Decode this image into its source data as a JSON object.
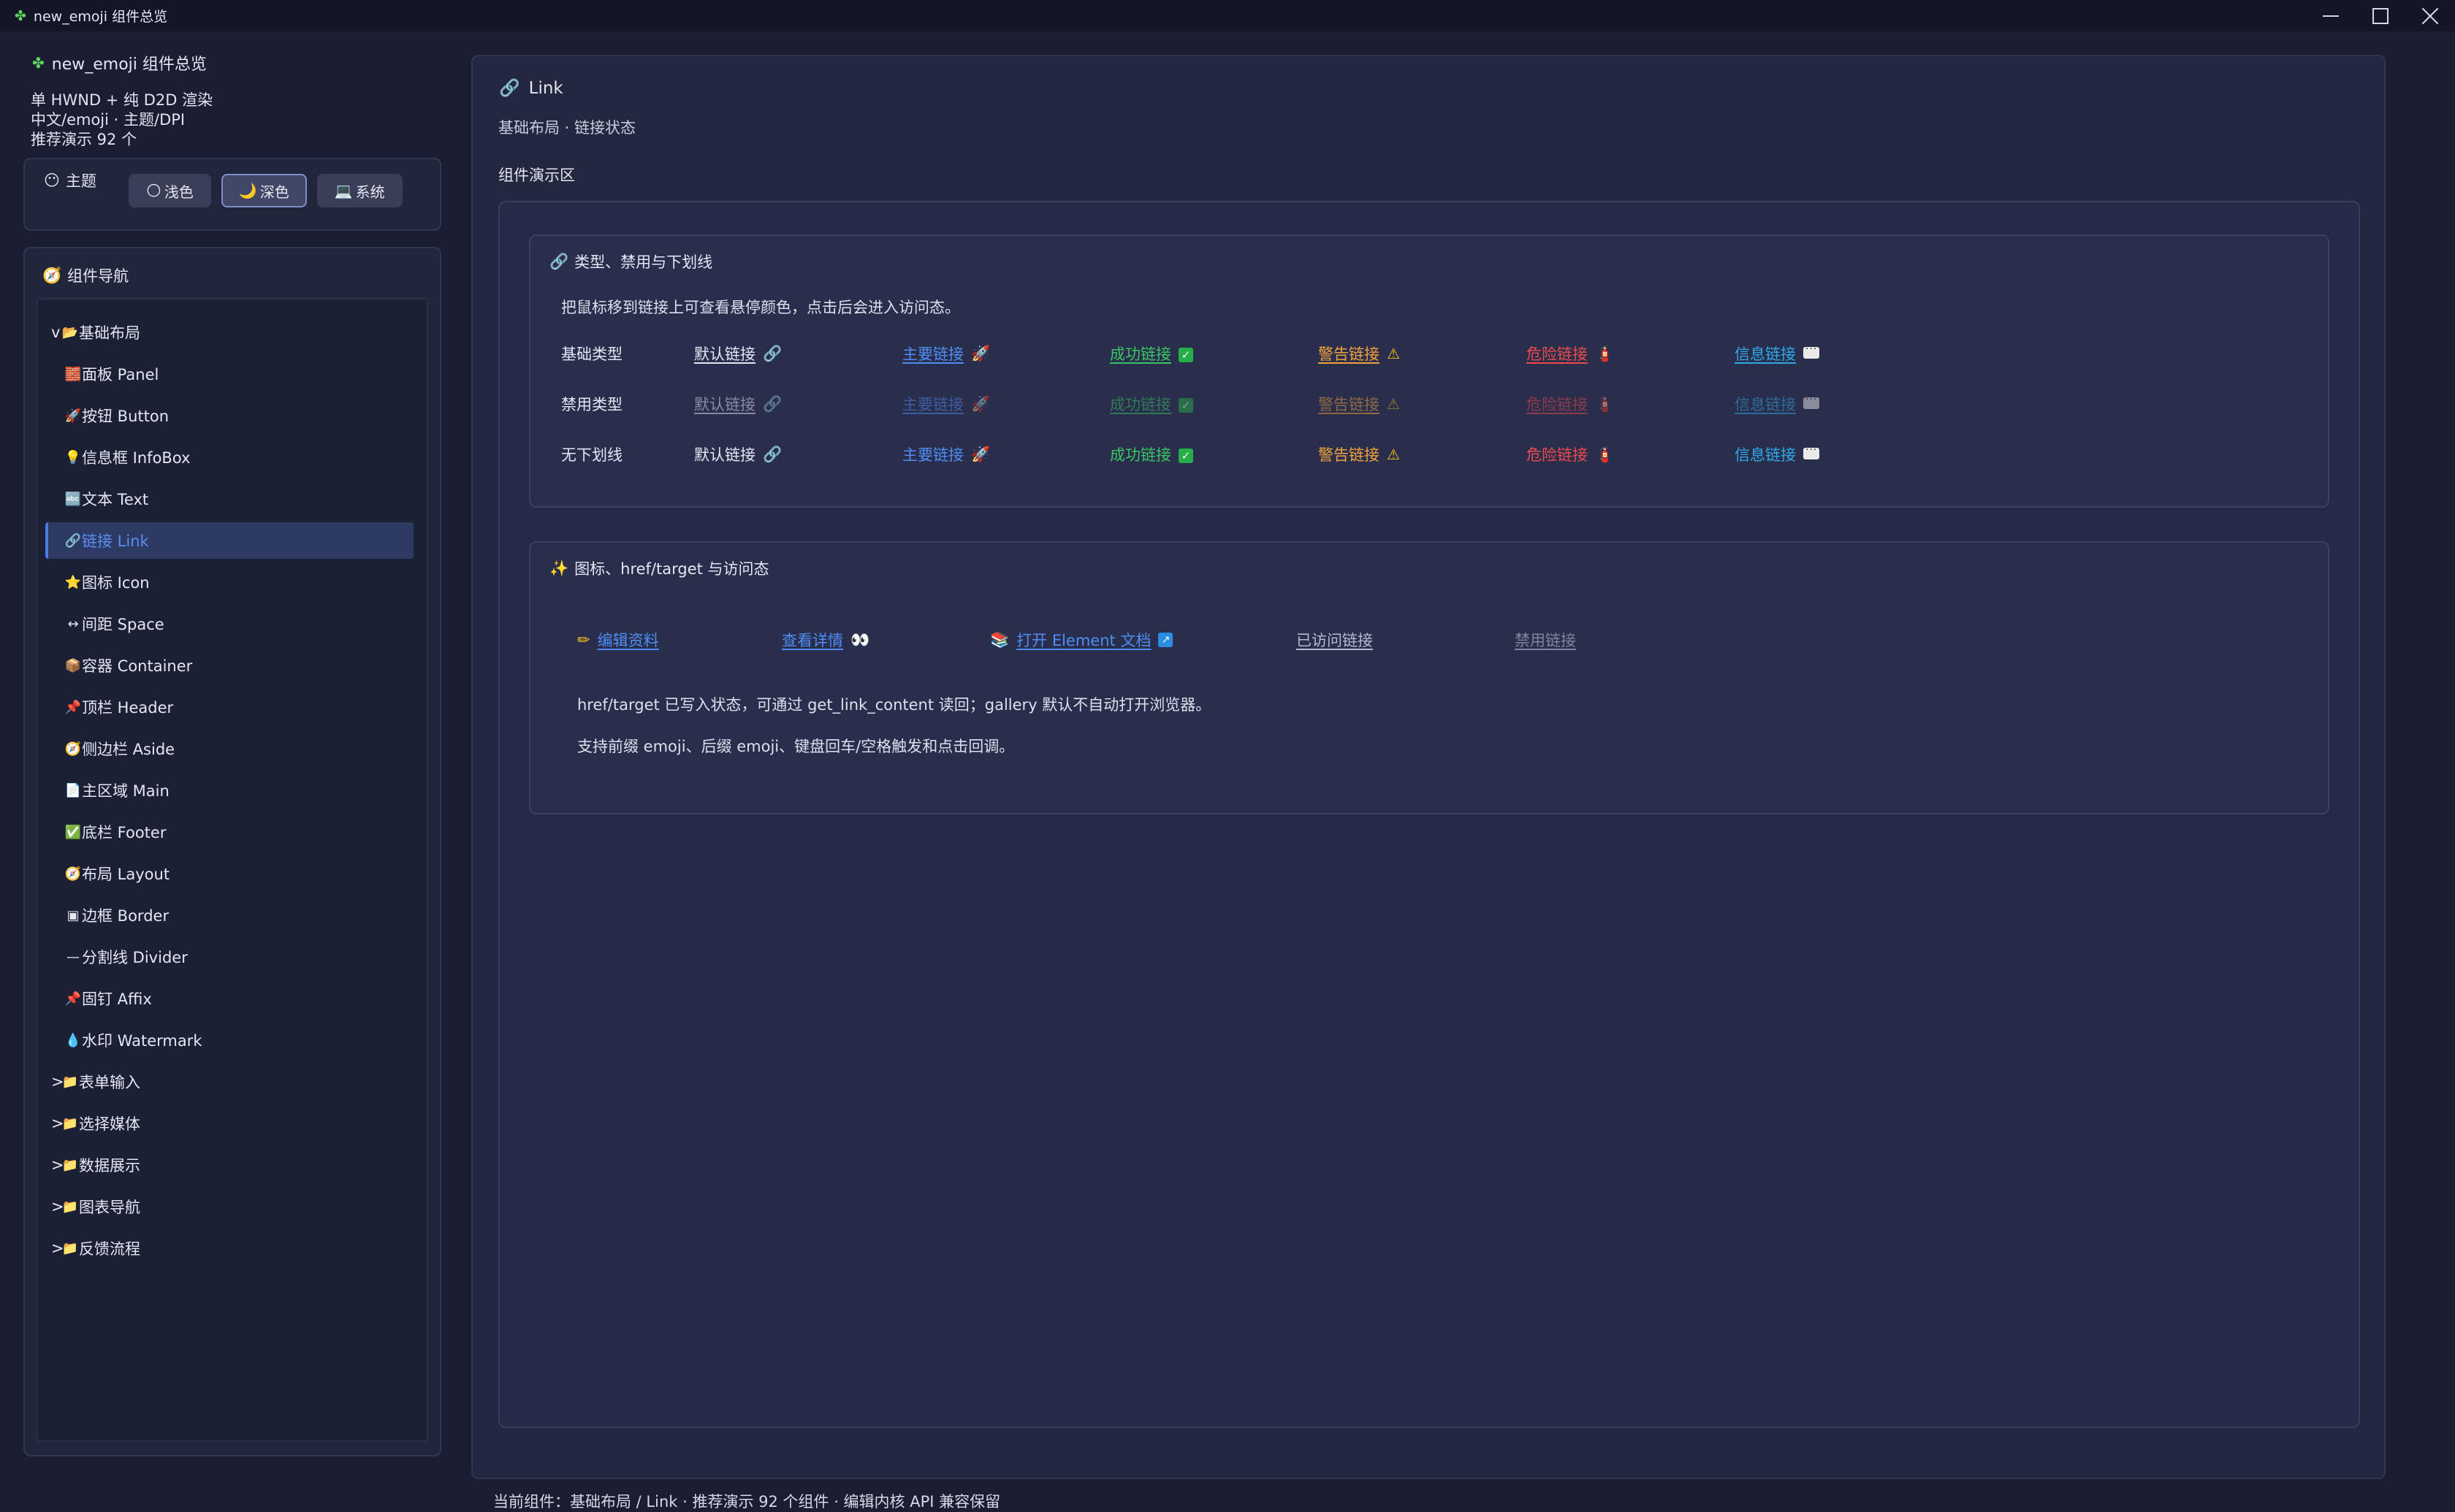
{
  "window": {
    "icon": "puzzle-icon",
    "title": "new_emoji 组件总览"
  },
  "brand": {
    "title": "new_emoji 组件总览",
    "lines": [
      "单 HWND + 纯 D2D 渲染",
      "中文/emoji · 主题/DPI",
      "推荐演示 92 个"
    ]
  },
  "theme": {
    "title": "主题",
    "buttons": [
      {
        "icon": "🌕",
        "label": "浅色",
        "active": false
      },
      {
        "icon": "🌙",
        "label": "深色",
        "active": true
      },
      {
        "icon": "💻",
        "label": "系统",
        "active": false
      }
    ]
  },
  "nav": {
    "title": "组件导航",
    "items": [
      {
        "prefix": "v",
        "icon": "📂",
        "label": "基础布局"
      },
      {
        "icon": "🧱",
        "label": "面板 Panel"
      },
      {
        "icon": "🚀",
        "label": "按钮 Button"
      },
      {
        "icon": "💡",
        "label": "信息框 InfoBox"
      },
      {
        "icon": "🔤",
        "label": "文本 Text"
      },
      {
        "icon": "🔗",
        "label": "链接 Link",
        "active": true
      },
      {
        "icon": "⭐",
        "label": "图标 Icon"
      },
      {
        "icon": "↔",
        "label": "间距 Space"
      },
      {
        "icon": "📦",
        "label": "容器 Container"
      },
      {
        "icon": "📌",
        "label": "顶栏 Header"
      },
      {
        "icon": "🧭",
        "label": "侧边栏 Aside"
      },
      {
        "icon": "📄",
        "label": "主区域 Main"
      },
      {
        "icon": "✅",
        "label": "底栏 Footer"
      },
      {
        "icon": "🧭",
        "label": "布局 Layout"
      },
      {
        "icon": "▣",
        "label": "边框 Border"
      },
      {
        "icon": "—",
        "label": "分割线 Divider"
      },
      {
        "icon": "📌",
        "label": "固钉 Affix"
      },
      {
        "icon": "💧",
        "label": "水印 Watermark"
      },
      {
        "prefix": ">",
        "icon": "📁",
        "label": "表单输入"
      },
      {
        "prefix": ">",
        "icon": "📁",
        "label": "选择媒体"
      },
      {
        "prefix": ">",
        "icon": "📁",
        "label": "数据展示"
      },
      {
        "prefix": ">",
        "icon": "📁",
        "label": "图表导航"
      },
      {
        "prefix": ">",
        "icon": "📁",
        "label": "反馈流程"
      }
    ]
  },
  "page": {
    "title": "Link",
    "breadcrumb": "基础布局 · 链接状态",
    "demo_label": "组件演示区"
  },
  "section1": {
    "title": "类型、禁用与下划线",
    "desc": "把鼠标移到链接上可查看悬停颜色，点击后会进入访问态。",
    "rows": [
      {
        "label": "基础类型",
        "disabled": false,
        "underline": true
      },
      {
        "label": "禁用类型",
        "disabled": true,
        "underline": true
      },
      {
        "label": "无下划线",
        "disabled": false,
        "underline": false
      }
    ],
    "links": [
      {
        "text": "默认链接",
        "type": "default",
        "icon": "link-icon"
      },
      {
        "text": "主要链接",
        "type": "primary",
        "icon": "rocket-icon"
      },
      {
        "text": "成功链接",
        "type": "success",
        "icon": "check-icon"
      },
      {
        "text": "警告链接",
        "type": "warning",
        "icon": "warning-icon"
      },
      {
        "text": "危险链接",
        "type": "danger",
        "icon": "extinguisher-icon"
      },
      {
        "text": "信息链接",
        "type": "info",
        "icon": "speech-bubble-icon"
      }
    ]
  },
  "section2": {
    "title": "图标、href/target 与访问态",
    "links": [
      {
        "prefix": "✏",
        "text": "编辑资料",
        "suffix": "",
        "type": "primary"
      },
      {
        "prefix": "",
        "text": "查看详情",
        "suffix": "👀",
        "type": "primary"
      },
      {
        "prefix": "📚",
        "text": "打开 Element 文档",
        "suffix": "↗",
        "type": "primary"
      },
      {
        "prefix": "",
        "text": "已访问链接",
        "suffix": "",
        "type": "visited"
      },
      {
        "prefix": "",
        "text": "禁用链接",
        "suffix": "",
        "type": "disabled"
      }
    ],
    "para1": "href/target 已写入状态，可通过 get_link_content 读回；gallery 默认不自动打开浏览器。",
    "para2": "支持前缀 emoji、后缀 emoji、键盘回车/空格触发和点击回调。"
  },
  "status": "当前组件：基础布局 / Link · 推荐演示 92 个组件 · 编辑内核 API 兼容保留",
  "colors": {
    "default": "#e4e7f2",
    "primary": "#4e8df5",
    "success": "#3ac561",
    "warning": "#f0a23a",
    "danger": "#ef4a4a",
    "info": "#2fa8e8",
    "background": "#1b1e33",
    "panel": "#23273f"
  }
}
